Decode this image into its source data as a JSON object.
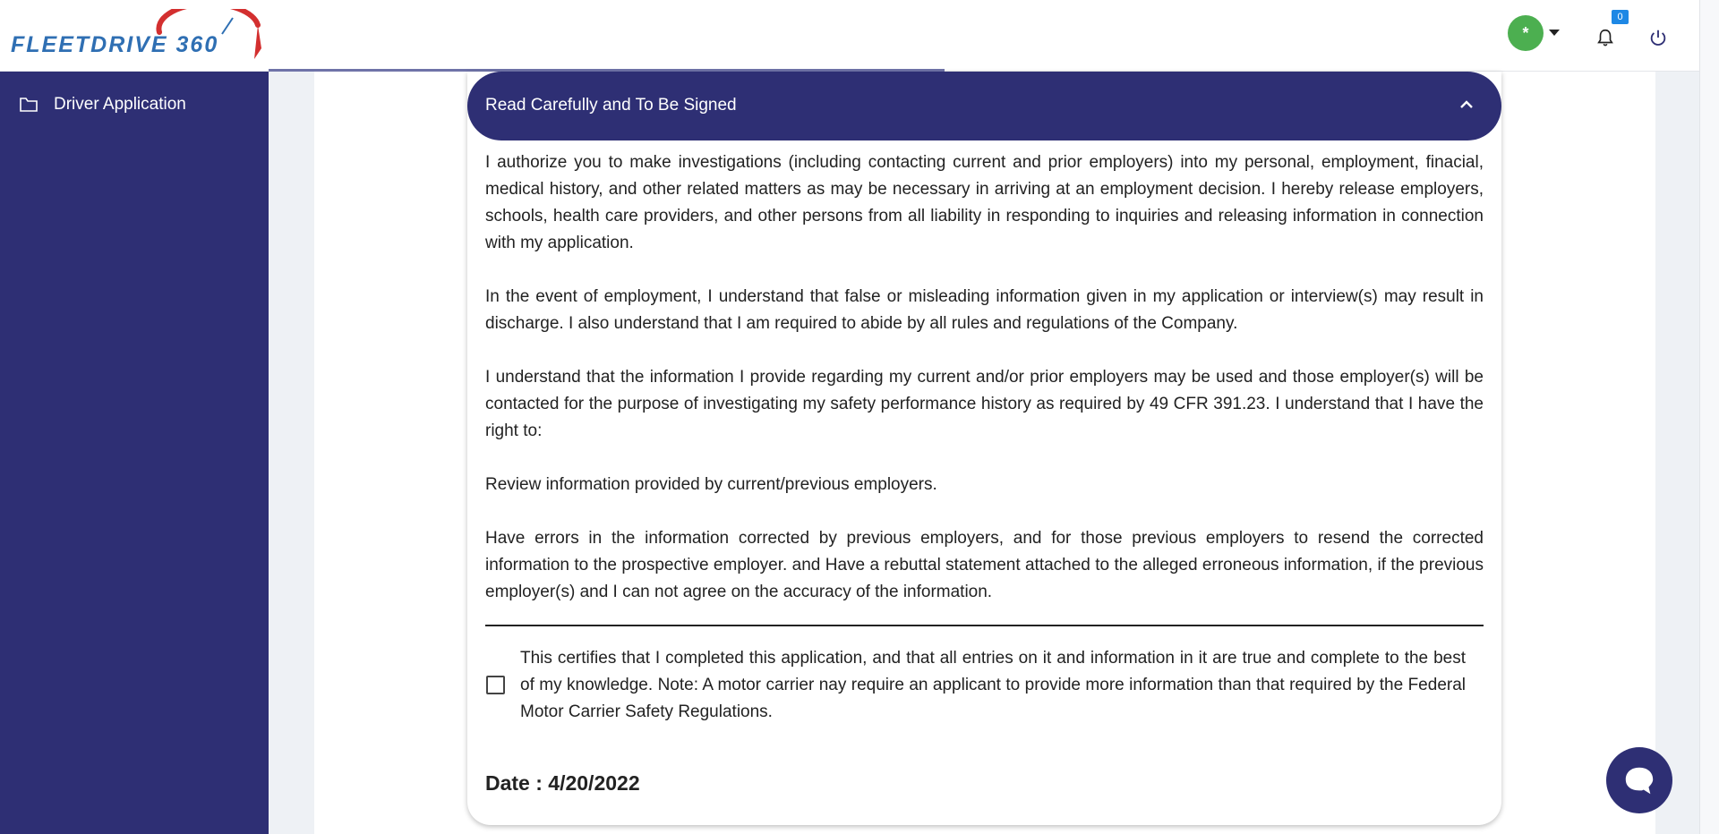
{
  "brand": {
    "logo_text": "FLEETDRIVE 360",
    "primary_color": "#2e2f74",
    "logo_blue": "#2f6fb3",
    "logo_red": "#d32f2f"
  },
  "header": {
    "avatar_initial": "*",
    "avatar_color": "#4caf50",
    "notification_count": "0",
    "icons": [
      "user-avatar",
      "caret-down-icon",
      "bell-icon",
      "power-icon"
    ]
  },
  "sidebar": {
    "items": [
      {
        "label": "Driver Application",
        "icon": "folder-icon"
      }
    ]
  },
  "section": {
    "title": "Read Carefully and To Be Signed",
    "toggle_icon": "chevron-up-icon",
    "paragraphs": [
      "I authorize you to make investigations (including contacting current and prior employers) into my personal, employment, finacial, medical history, and other related matters as may be necessary in arriving at an employment decision. I hereby release employers, schools, health care providers, and other persons from all liability in responding to inquiries and releasing information in connection with my application.",
      "In the event of employment, I understand that false or misleading information given in my application or interview(s) may result in discharge. I also understand that I am required to abide by all rules and regulations of the Company.",
      "I understand that the information I provide regarding my current and/or prior employers may be used and those employer(s) will be contacted for the purpose of investigating my safety performance history as required by 49 CFR 391.23. I understand that I have the right to:",
      "Review information provided by current/previous employers.",
      "Have errors in the information corrected by previous employers, and for those previous employers to resend the corrected information to the prospective employer. and Have a rebuttal statement attached to the alleged erroneous information, if the previous employer(s) and I can not agree on the accuracy of the information."
    ],
    "certification": {
      "checked": false,
      "text": "This certifies that I completed this application, and that all entries on it and information in it are true and complete to the best of my knowledge. Note: A motor carrier nay require an applicant to provide more information than that required by the Federal Motor Carrier Safety Regulations."
    },
    "date_text": "Date : 4/20/2022"
  },
  "chat": {
    "icon": "chat-bubble-icon"
  }
}
